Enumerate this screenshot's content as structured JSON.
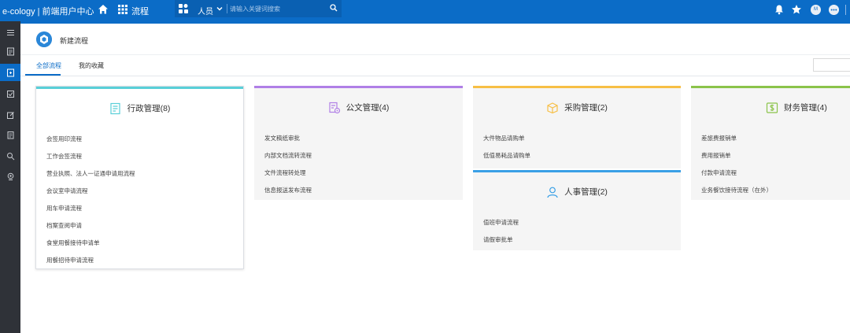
{
  "topbar": {
    "brand": "e-cology | 前端用户中心",
    "nav_flow": "流程",
    "search_type": "人员",
    "search_placeholder": "请输入关键词搜索",
    "avatar_label": "M"
  },
  "page_header": {
    "title": "新建流程"
  },
  "tabs": {
    "all": "全部流程",
    "fav": "我的收藏"
  },
  "cards": [
    {
      "title": "行政管理(8)",
      "color": "#59cfd8",
      "icon": "document-list-icon",
      "items": [
        "会签用印流程",
        "工作会签流程",
        "营业执照、法人一证通申请用流程",
        "会议室申请流程",
        "用车申请流程",
        "档案查阅申请",
        "食堂用餐接待申请单",
        "用餐招待申请流程"
      ]
    },
    {
      "title": "公文管理(4)",
      "color": "#b07fe6",
      "icon": "document-gear-icon",
      "items": [
        "发文稿纸审批",
        "内部文档流转流程",
        "文件流程转处理",
        "信息报送发布流程"
      ]
    },
    {
      "title": "采购管理(2)",
      "color": "#f7bf45",
      "icon": "package-icon",
      "items": [
        "大件物品请购单",
        "低值易耗品请购单"
      ]
    },
    {
      "title": "人事管理(2)",
      "color": "#3aa0e6",
      "icon": "person-icon",
      "items": [
        "值班申请流程",
        "请假审批单"
      ]
    },
    {
      "title": "财务管理(4)",
      "color": "#8bc34a",
      "icon": "money-icon",
      "items": [
        "差旅费报销单",
        "费用报销单",
        "付款申请流程",
        "业务餐饮接待流程（在外）"
      ]
    }
  ]
}
